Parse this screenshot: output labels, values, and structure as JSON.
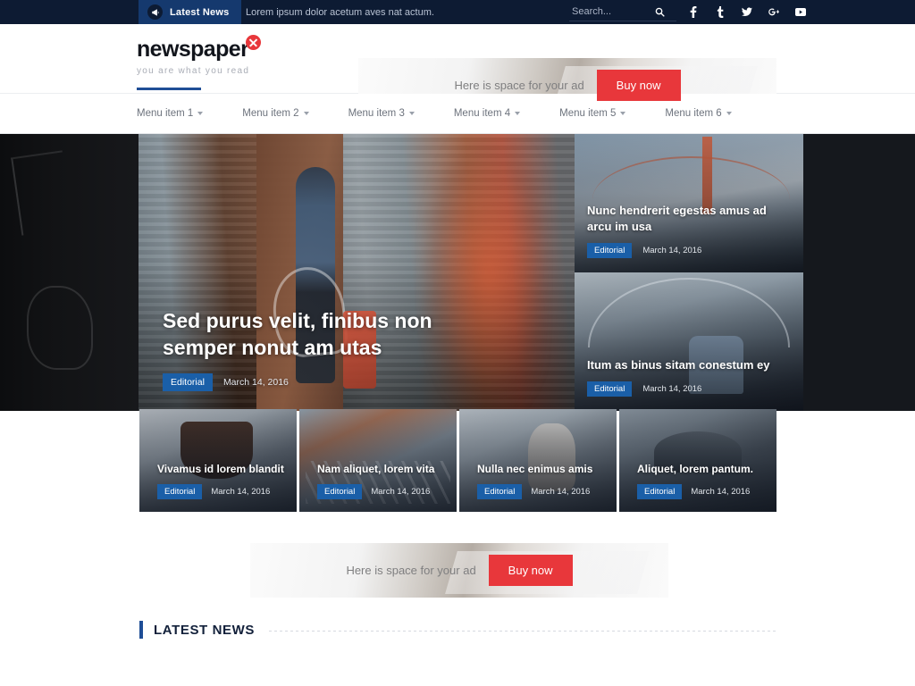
{
  "topbar": {
    "latest_news_label": "Latest News",
    "megaphone_icon": "megaphone-icon",
    "ticker_text": "Lorem ipsum dolor acetum aves nat actum.",
    "search_placeholder": "Search...",
    "search_value": "",
    "search_icon": "search-icon",
    "socials": [
      {
        "name": "facebook-icon",
        "glyph": "f"
      },
      {
        "name": "tumblr-icon",
        "glyph": "t"
      },
      {
        "name": "twitter-icon",
        "glyph": "❖"
      },
      {
        "name": "google-plus-icon",
        "glyph": "g"
      },
      {
        "name": "youtube-icon",
        "glyph": "▶"
      }
    ]
  },
  "header": {
    "logo_word": "newspaper",
    "logo_badge_icon": "x-badge-icon",
    "tagline": "you are what you read",
    "ad": {
      "text": "Here is space for your ad",
      "button_label": "Buy now",
      "accent_color": "#e8373b"
    }
  },
  "nav": {
    "items": [
      {
        "label": "Menu item 1",
        "active": true
      },
      {
        "label": "Menu item 2",
        "active": false
      },
      {
        "label": "Menu item 3",
        "active": false
      },
      {
        "label": "Menu item 4",
        "active": false
      },
      {
        "label": "Menu item 5",
        "active": false
      },
      {
        "label": "Menu item 6",
        "active": false
      }
    ],
    "active_indicator_color": "#1f4e96"
  },
  "hero": {
    "main": {
      "title": "Sed purus velit, finibus non semper nonut am utas",
      "category": "Editorial",
      "date": "March 14, 2016"
    },
    "side": [
      {
        "title": "Nunc hendrerit egestas amus ad arcu im usa",
        "category": "Editorial",
        "date": "March 14, 2016"
      },
      {
        "title": "Itum as binus sitam conestum ey",
        "category": "Editorial",
        "date": "March 14, 2016"
      }
    ]
  },
  "cards": [
    {
      "title": "Vivamus id lorem blandit",
      "category": "Editorial",
      "date": "March 14, 2016"
    },
    {
      "title": "Nam aliquet, lorem vita",
      "category": "Editorial",
      "date": "March 14, 2016"
    },
    {
      "title": "Nulla nec enimus amis",
      "category": "Editorial",
      "date": "March 14, 2016"
    },
    {
      "title": "Aliquet, lorem pantum.",
      "category": "Editorial",
      "date": "March 14, 2016"
    }
  ],
  "ad_bottom": {
    "text": "Here is space for your ad",
    "button_label": "Buy now"
  },
  "latest_news": {
    "heading": "LATEST NEWS"
  },
  "colors": {
    "topbar_bg": "#0d1b33",
    "badge_blue": "#15396e",
    "category_blue": "#1a5fa8",
    "accent_red": "#e8373b",
    "nav_active": "#1f4e96"
  }
}
